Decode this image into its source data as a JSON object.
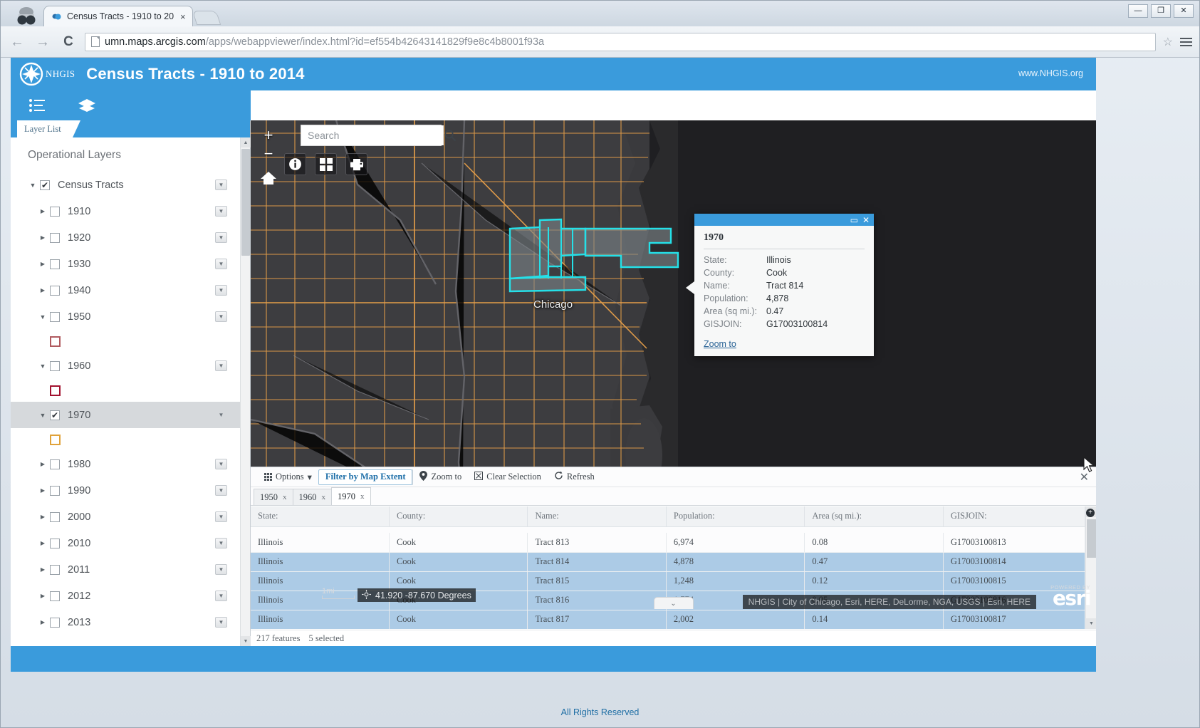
{
  "browser": {
    "tab_title": "Census Tracts - 1910 to 20",
    "tab_close": "×",
    "url_host": "umn.maps.arcgis.com",
    "url_path": "/apps/webappviewer/index.html?id=ef554b42643141829f9e8c4b8001f93a",
    "win_minimize": "—",
    "win_maximize": "❐",
    "win_close": "✕",
    "back_arrow": "←",
    "forward_arrow": "→",
    "reload_glyph": "C",
    "star_glyph": "☆"
  },
  "app": {
    "logo_word": "NHGIS",
    "title": "Census Tracts - 1910 to 2014",
    "site_url": "www.NHGIS.org"
  },
  "panel": {
    "tab_label": "Layer List",
    "heading": "Operational Layers",
    "root": {
      "label": "Census Tracts",
      "checked": true,
      "expanded": true
    },
    "layers": [
      {
        "label": "1910",
        "checked": false,
        "expanded": false,
        "swatch": null
      },
      {
        "label": "1920",
        "checked": false,
        "expanded": false,
        "swatch": null
      },
      {
        "label": "1930",
        "checked": false,
        "expanded": false,
        "swatch": null
      },
      {
        "label": "1940",
        "checked": false,
        "expanded": false,
        "swatch": null
      },
      {
        "label": "1950",
        "checked": false,
        "expanded": true,
        "swatch": "#b05a5f"
      },
      {
        "label": "1960",
        "checked": false,
        "expanded": true,
        "swatch": "#a2112f"
      },
      {
        "label": "1970",
        "checked": true,
        "expanded": true,
        "swatch": "#e0a23a",
        "selected": true
      },
      {
        "label": "1980",
        "checked": false,
        "expanded": false,
        "swatch": null
      },
      {
        "label": "1990",
        "checked": false,
        "expanded": false,
        "swatch": null
      },
      {
        "label": "2000",
        "checked": false,
        "expanded": false,
        "swatch": null
      },
      {
        "label": "2010",
        "checked": false,
        "expanded": false,
        "swatch": null
      },
      {
        "label": "2011",
        "checked": false,
        "expanded": false,
        "swatch": null
      },
      {
        "label": "2012",
        "checked": false,
        "expanded": false,
        "swatch": null
      },
      {
        "label": "2013",
        "checked": false,
        "expanded": false,
        "swatch": null
      }
    ],
    "collapse_glyph": "«"
  },
  "map": {
    "search_placeholder": "Search",
    "zoom_in": "+",
    "zoom_out": "−",
    "scale_label": "1mi",
    "coordinates": "41.920 -87.670 Degrees",
    "attribution": "NHGIS | City of Chicago, Esri, HERE, DeLorme, NGA, USGS | Esri, HERE",
    "esri_powered": "POWERED BY",
    "esri_word": "esri",
    "city_label": "Chicago",
    "handle_glyph": "⌄"
  },
  "popup": {
    "title": "1970",
    "maximize_glyph": "▭",
    "close_glyph": "✕",
    "fields": [
      {
        "key": "State:",
        "value": "Illinois"
      },
      {
        "key": "County:",
        "value": "Cook"
      },
      {
        "key": "Name:",
        "value": "Tract 814"
      },
      {
        "key": "Population:",
        "value": "4,878"
      },
      {
        "key": "Area (sq mi.):",
        "value": "0.47"
      },
      {
        "key": "GISJOIN:",
        "value": "G17003100814"
      }
    ],
    "zoom_to": "Zoom to"
  },
  "attribute_table": {
    "toolbar": {
      "options": "Options",
      "options_caret": "▾",
      "filter_by_map_extent": "Filter by Map Extent",
      "zoom_to": "Zoom to",
      "clear_selection": "Clear Selection",
      "refresh": "Refresh",
      "close_glyph": "✕"
    },
    "tabs": [
      {
        "label": "1950",
        "close": "x",
        "active": false
      },
      {
        "label": "1960",
        "close": "x",
        "active": false
      },
      {
        "label": "1970",
        "close": "x",
        "active": true
      }
    ],
    "columns": [
      "State:",
      "County:",
      "Name:",
      "Population:",
      "Area (sq mi.):",
      "GISJOIN:"
    ],
    "rows": [
      {
        "cells": [
          "Illinois",
          "Cook",
          "Tract 813",
          "6,974",
          "0.08",
          "G17003100813"
        ],
        "selected": false
      },
      {
        "cells": [
          "Illinois",
          "Cook",
          "Tract 814",
          "4,878",
          "0.47",
          "G17003100814"
        ],
        "selected": true
      },
      {
        "cells": [
          "Illinois",
          "Cook",
          "Tract 815",
          "1,248",
          "0.12",
          "G17003100815"
        ],
        "selected": true
      },
      {
        "cells": [
          "Illinois",
          "Cook",
          "Tract 816",
          "1,774",
          "0.05",
          "G17003100816"
        ],
        "selected": true
      },
      {
        "cells": [
          "Illinois",
          "Cook",
          "Tract 817",
          "2,002",
          "0.14",
          "G17003100817"
        ],
        "selected": true
      }
    ],
    "status_features": "217 features",
    "status_selected": "5 selected",
    "add_column_glyph": "+"
  },
  "footer": {
    "rights": "All Rights Reserved"
  },
  "colors": {
    "brand_blue": "#3a9bdc",
    "selection_cyan": "#25e0e8",
    "row_selected": "#accbe6",
    "map_bg": "#2a2a2c",
    "road_orange": "#e8a04a"
  }
}
